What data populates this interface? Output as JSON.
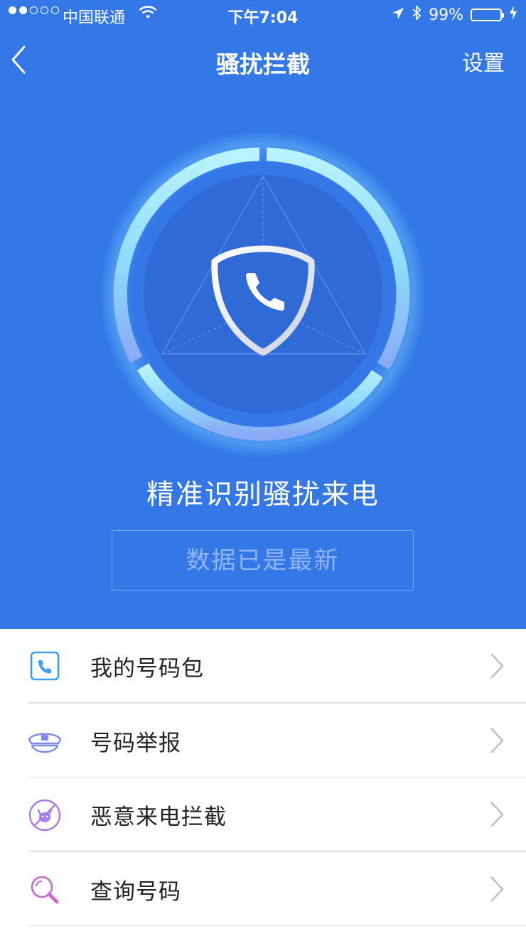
{
  "status_bar": {
    "carrier": "中国联通",
    "time": "下午7:04",
    "battery": "99%",
    "signal_filled": 2,
    "signal_total": 5
  },
  "nav": {
    "back_icon": "chevron-left-icon",
    "title": "骚扰拦截",
    "settings": "设置"
  },
  "hero": {
    "headline": "精准识别骚扰来电",
    "update_button": "数据已是最新",
    "shield_icon": "shield-phone-icon",
    "accent": "#3478e8"
  },
  "menu": [
    {
      "label": "我的号码包",
      "icon": "phone-book-icon"
    },
    {
      "label": "号码举报",
      "icon": "police-cap-icon"
    },
    {
      "label": "恶意来电拦截",
      "icon": "devil-block-icon"
    },
    {
      "label": "查询号码",
      "icon": "magnifier-icon"
    }
  ]
}
